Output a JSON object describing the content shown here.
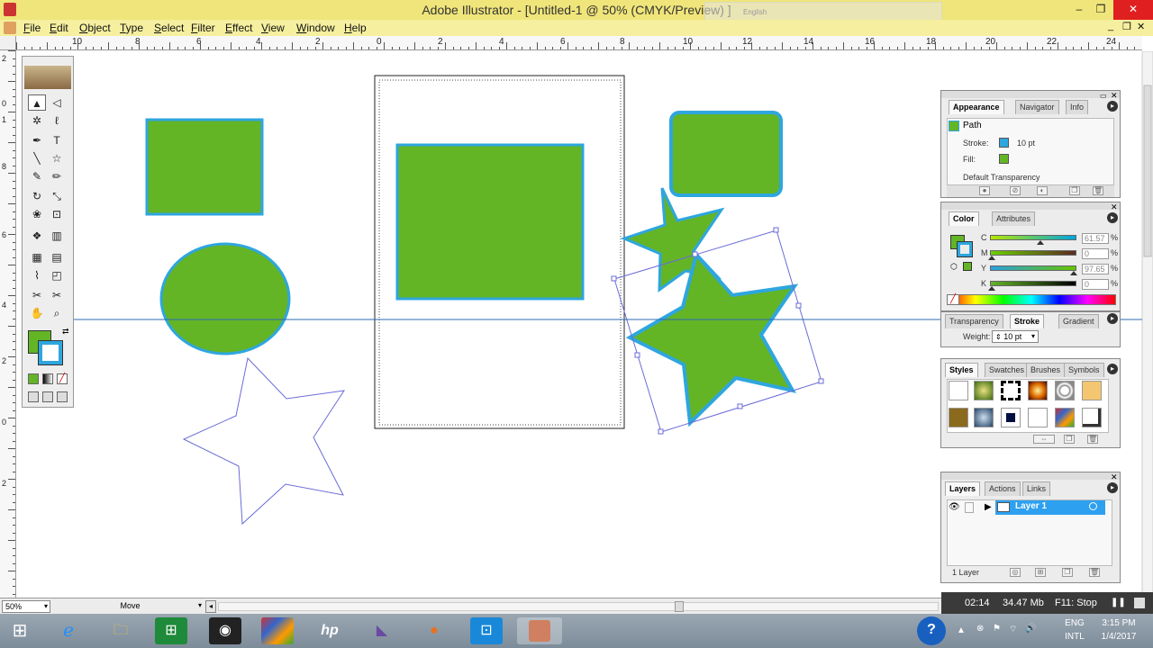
{
  "window": {
    "title": "Adobe Illustrator - [Untitled-1 @ 50% (CMYK/Preview) ]",
    "controls": {
      "minimize": "–",
      "restore": "❐",
      "close": "✕"
    },
    "inner_controls": {
      "minimize": "_",
      "restore": "❐",
      "close": "✕"
    }
  },
  "language_bar": {
    "label": "English"
  },
  "menu": [
    {
      "label": "File",
      "u": "F",
      "rest": "ile"
    },
    {
      "label": "Edit",
      "u": "E",
      "rest": "dit"
    },
    {
      "label": "Object",
      "u": "O",
      "rest": "bject"
    },
    {
      "label": "Type",
      "u": "T",
      "rest": "ype"
    },
    {
      "label": "Select",
      "u": "S",
      "rest": "elect"
    },
    {
      "label": "Filter",
      "u": "F",
      "rest": "ilter"
    },
    {
      "label": "Effect",
      "u": "E",
      "rest": "ffect"
    },
    {
      "label": "View",
      "u": "V",
      "rest": "iew"
    },
    {
      "label": "Window",
      "u": "W",
      "rest": "indow"
    },
    {
      "label": "Help",
      "u": "H",
      "rest": "elp"
    }
  ],
  "ruler": {
    "h_labels": [
      "10",
      "8",
      "6",
      "4",
      "2",
      "0",
      "2",
      "4",
      "6",
      "8",
      "10",
      "12",
      "14",
      "16",
      "18",
      "20",
      "22",
      "24"
    ],
    "v_labels": [
      "2",
      "0",
      "1",
      "8",
      "6",
      "4",
      "2",
      "0",
      "2"
    ]
  },
  "document": {
    "fill_color": "#63b526",
    "stroke_color": "#2ea6de",
    "guide_color": "#2b6bb0"
  },
  "toolbox": {
    "tools": [
      [
        "selection-tool",
        "▲"
      ],
      [
        "direct-selection-tool",
        "◁"
      ],
      [
        "magic-wand-tool",
        "✲"
      ],
      [
        "lasso-tool",
        "ℓ"
      ],
      [
        "pen-tool",
        "✒"
      ],
      [
        "type-tool",
        "T"
      ],
      [
        "line-tool",
        "╲"
      ],
      [
        "star-tool",
        "☆"
      ],
      [
        "paintbrush-tool",
        "✎"
      ],
      [
        "pencil-tool",
        "✏"
      ],
      [
        "rotate-tool",
        "↻"
      ],
      [
        "scale-tool",
        "⤡"
      ],
      [
        "warp-tool",
        "❀"
      ],
      [
        "free-transform-tool",
        "⊡"
      ],
      [
        "symbol-sprayer-tool",
        "❖"
      ],
      [
        "graph-tool",
        "▥"
      ],
      [
        "mesh-tool",
        "▦"
      ],
      [
        "gradient-tool",
        "▤"
      ],
      [
        "eyedropper-tool",
        "⌇"
      ],
      [
        "blend-tool",
        "◰"
      ],
      [
        "slice-tool",
        "✂"
      ],
      [
        "scissors-tool",
        "✂"
      ],
      [
        "hand-tool",
        "✋"
      ],
      [
        "zoom-tool",
        "⌕"
      ]
    ]
  },
  "appearance_panel": {
    "tabs": [
      "Appearance",
      "Navigator",
      "Info"
    ],
    "object": "Path",
    "stroke_label": "Stroke:",
    "stroke_value": "10 pt",
    "fill_label": "Fill:",
    "transparency": "Default Transparency"
  },
  "color_panel": {
    "tabs": [
      "Color",
      "Attributes"
    ],
    "channels": [
      {
        "label": "C",
        "value": "61.57",
        "unit": "%"
      },
      {
        "label": "M",
        "value": "0",
        "unit": "%"
      },
      {
        "label": "Y",
        "value": "97.65",
        "unit": "%"
      },
      {
        "label": "K",
        "value": "0",
        "unit": "%"
      }
    ]
  },
  "stroke_panel": {
    "tabs": [
      "Transparency",
      "Stroke",
      "Gradient"
    ],
    "weight_label": "Weight:",
    "weight_value": "10 pt"
  },
  "styles_panel": {
    "tabs": [
      "Styles",
      "Swatches",
      "Brushes",
      "Symbols"
    ]
  },
  "layers_panel": {
    "tabs": [
      "Layers",
      "Actions",
      "Links"
    ],
    "layer_name": "Layer 1",
    "footer": "1 Layer"
  },
  "status": {
    "zoom": "50%",
    "tool": "Move"
  },
  "recorder": {
    "time": "02:14",
    "size": "34.47 Mb",
    "hint": "F11: Stop"
  },
  "taskbar": {
    "lang": "ENG",
    "layout": "INTL",
    "time": "3:15 PM",
    "date": "1/4/2017"
  }
}
